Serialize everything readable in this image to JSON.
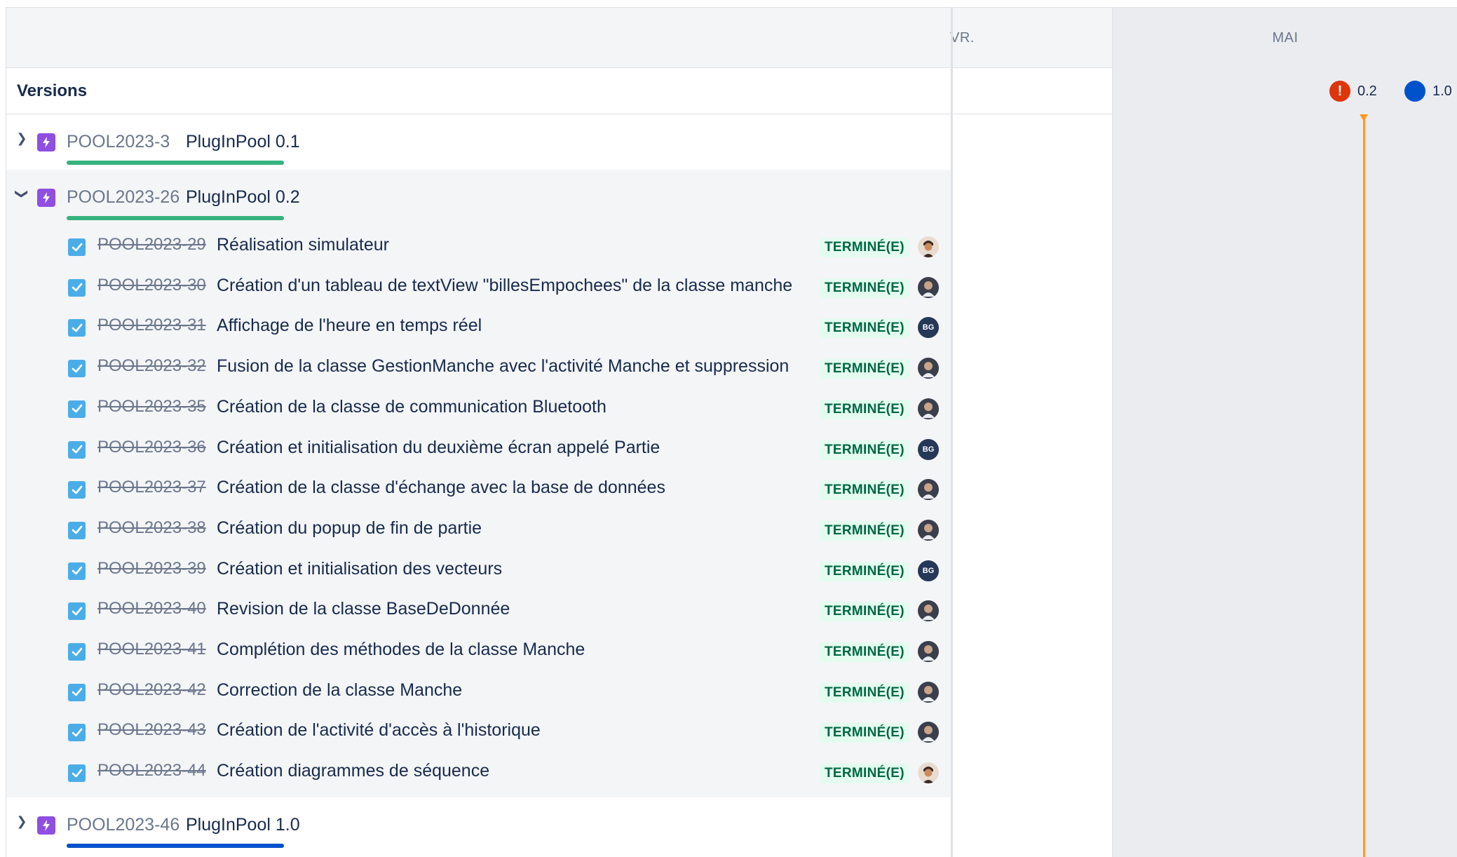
{
  "timeline": {
    "months": [
      "VR.",
      "MAI"
    ]
  },
  "versions": {
    "label": "Versions",
    "markers": [
      {
        "label": "0.2",
        "kind": "alert"
      },
      {
        "label": "1.0",
        "kind": "dot"
      }
    ]
  },
  "epics": [
    {
      "key": "POOL2023-3",
      "title": "PlugInPool 0.1",
      "expanded": false,
      "bar_color": "#36b37e"
    },
    {
      "key": "POOL2023-26",
      "title": "PlugInPool 0.2",
      "expanded": true,
      "bar_color": "#36b37e"
    },
    {
      "key": "POOL2023-46",
      "title": "PlugInPool 1.0",
      "expanded": false,
      "bar_color": "#0052cc"
    }
  ],
  "children": [
    {
      "key": "POOL2023-29",
      "title": "Réalisation simulateur",
      "status": "TERMINÉ(E)",
      "avatar": "photo-b"
    },
    {
      "key": "POOL2023-30",
      "title": "Création d'un tableau de textView \"billesEmpochees\" de la classe manche",
      "status": "TERMINÉ(E)",
      "avatar": "photo-a"
    },
    {
      "key": "POOL2023-31",
      "title": "Affichage de l'heure en temps réel",
      "status": "TERMINÉ(E)",
      "avatar": "BG"
    },
    {
      "key": "POOL2023-32",
      "title": "Fusion de la classe GestionManche avec l'activité Manche et suppression",
      "status": "TERMINÉ(E)",
      "avatar": "photo-a"
    },
    {
      "key": "POOL2023-35",
      "title": "Création de la classe de communication Bluetooth",
      "status": "TERMINÉ(E)",
      "avatar": "photo-a"
    },
    {
      "key": "POOL2023-36",
      "title": "Création et initialisation du deuxième écran appelé Partie",
      "status": "TERMINÉ(E)",
      "avatar": "BG"
    },
    {
      "key": "POOL2023-37",
      "title": "Création de la classe d'échange avec la base de données",
      "status": "TERMINÉ(E)",
      "avatar": "photo-a"
    },
    {
      "key": "POOL2023-38",
      "title": "Création du popup de fin de partie",
      "status": "TERMINÉ(E)",
      "avatar": "photo-a"
    },
    {
      "key": "POOL2023-39",
      "title": "Création et initialisation des vecteurs",
      "status": "TERMINÉ(E)",
      "avatar": "BG"
    },
    {
      "key": "POOL2023-40",
      "title": "Revision de la classe BaseDeDonnée",
      "status": "TERMINÉ(E)",
      "avatar": "photo-a"
    },
    {
      "key": "POOL2023-41",
      "title": "Complétion des méthodes de la classe Manche",
      "status": "TERMINÉ(E)",
      "avatar": "photo-a"
    },
    {
      "key": "POOL2023-42",
      "title": "Correction de la classe Manche",
      "status": "TERMINÉ(E)",
      "avatar": "photo-a"
    },
    {
      "key": "POOL2023-43",
      "title": "Création de l'activité d'accès à l'historique",
      "status": "TERMINÉ(E)",
      "avatar": "photo-a"
    },
    {
      "key": "POOL2023-44",
      "title": "Création diagrammes de séquence",
      "status": "TERMINÉ(E)",
      "avatar": "photo-b"
    }
  ],
  "colors": {
    "epic_icon": "#904ee2",
    "checkbox": "#4bade8",
    "status_bg": "#e3fcef",
    "status_text": "#006644",
    "today_line": "#ff991f"
  }
}
